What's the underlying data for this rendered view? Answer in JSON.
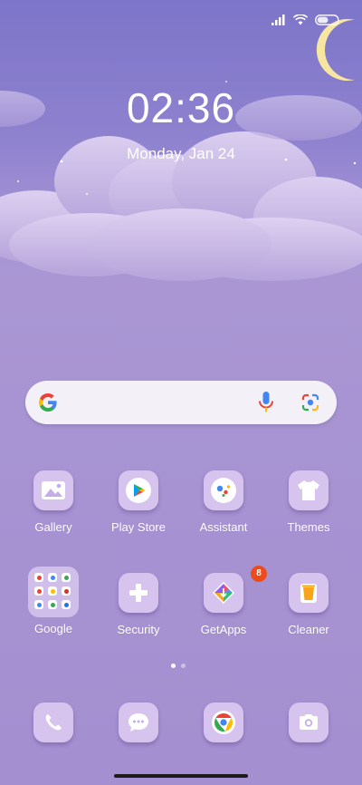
{
  "status": {
    "battery_percent": 55
  },
  "lockscreen": {
    "time": "02:36",
    "date": "Monday, Jan 24"
  },
  "page_indicator": {
    "count": 2,
    "active_index": 0
  },
  "colors": {
    "accent": "#d7c4ee",
    "badge": "#ee4b1c"
  },
  "apps_row1": [
    {
      "label": "Gallery",
      "icon": "gallery-icon"
    },
    {
      "label": "Play Store",
      "icon": "play-store-icon"
    },
    {
      "label": "Assistant",
      "icon": "assistant-icon"
    },
    {
      "label": "Themes",
      "icon": "themes-icon"
    }
  ],
  "apps_row2": [
    {
      "label": "Google",
      "icon": "folder-icon"
    },
    {
      "label": "Security",
      "icon": "security-icon"
    },
    {
      "label": "GetApps",
      "icon": "getapps-icon",
      "badge": "8"
    },
    {
      "label": "Cleaner",
      "icon": "cleaner-icon"
    }
  ],
  "dock": [
    {
      "icon": "phone-icon"
    },
    {
      "icon": "messages-icon"
    },
    {
      "icon": "chrome-icon"
    },
    {
      "icon": "camera-icon"
    }
  ]
}
